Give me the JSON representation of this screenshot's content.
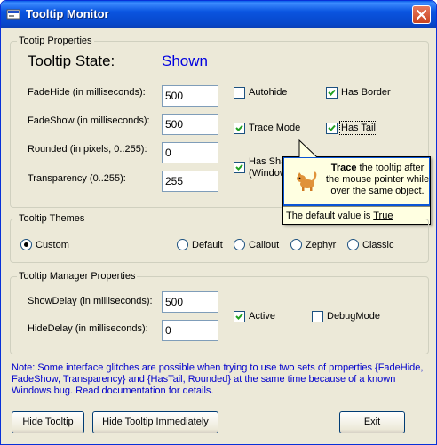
{
  "window": {
    "title": "Tooltip Monitor",
    "close_glyph": "close-icon"
  },
  "properties": {
    "group_title": "Tootip Properties",
    "state_label": "Tooltip State:",
    "state_value": "Shown",
    "fadehide_label": "FadeHide (in milliseconds):",
    "fadehide_value": "500",
    "fadeshow_label": "FadeShow (in milliseconds):",
    "fadeshow_value": "500",
    "rounded_label": "Rounded (in pixels, 0..255):",
    "rounded_value": "0",
    "transparency_label": "Transparency (0..255):",
    "transparency_value": "255",
    "autohide_label": "Autohide",
    "autohide_checked": false,
    "hasborder_label": "Has Border",
    "hasborder_checked": true,
    "tracemode_label": "Trace Mode",
    "tracemode_checked": true,
    "hastail_label": "Has Tail",
    "hastail_checked": true,
    "hasshadow_label_line1": "Has Sha",
    "hasshadow_label_line2": "(Window",
    "hasshadow_checked": true
  },
  "tooltip": {
    "bold_word": "Trace",
    "text": " the tooltip after the mouse pointer while over the same object.",
    "footer_prefix": "The default value is ",
    "footer_value": "True",
    "icon": "cat-icon"
  },
  "themes": {
    "group_title": "Tooltip Themes",
    "options": [
      {
        "label": "Custom",
        "selected": true
      },
      {
        "label": "Default",
        "selected": false
      },
      {
        "label": "Callout",
        "selected": false
      },
      {
        "label": "Zephyr",
        "selected": false
      },
      {
        "label": "Classic",
        "selected": false
      }
    ]
  },
  "manager": {
    "group_title": "Tooltip Manager Properties",
    "showdelay_label": "ShowDelay (in milliseconds):",
    "showdelay_value": "500",
    "hidedelay_label": "HideDelay (in milliseconds):",
    "hidedelay_value": "0",
    "active_label": "Active",
    "active_checked": true,
    "debugmode_label": "DebugMode",
    "debugmode_checked": false
  },
  "note": "Note: Some interface glitches are possible when trying to use two sets of properties {FadeHide, FadeShow, Transparency} and {HasTail, Rounded} at the same time because of a known Windows bug. Read documentation for details.",
  "buttons": {
    "hide_tooltip": "Hide Tooltip",
    "hide_immediately": "Hide Tooltip Immediately",
    "exit": "Exit"
  },
  "colors": {
    "state_value": "#0000e0",
    "note_text": "#0000cc",
    "tooltip_bg": "#ffffe1",
    "dialog_bg": "#ece9d8"
  }
}
